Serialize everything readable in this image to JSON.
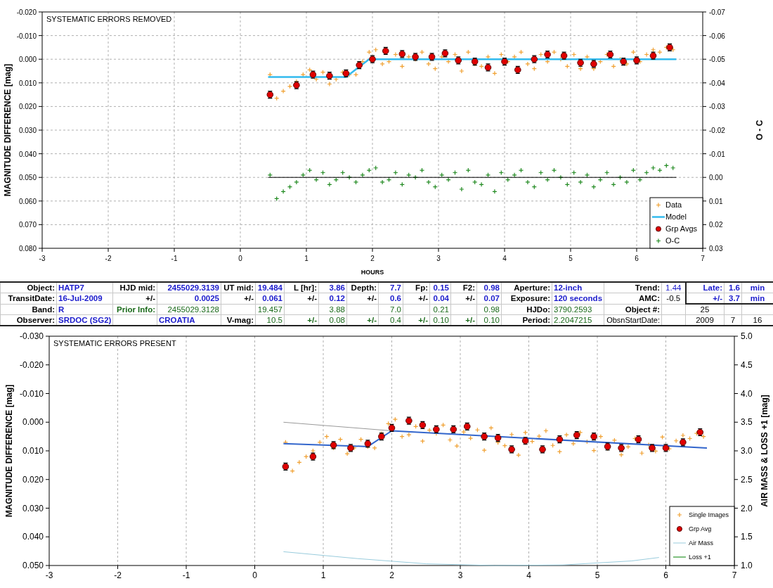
{
  "charts": [
    {
      "chart_data": {
        "type": "scatter",
        "title": "SYSTEMATIC ERRORS REMOVED",
        "xlabel": "HOURS",
        "ylabel": "MAGNITUDE DIFFERENCE [mag]",
        "y2label": "O - C",
        "xlim": [
          -3,
          7
        ],
        "ylim": [
          0.08,
          -0.02
        ],
        "y2lim": [
          0.03,
          -0.07
        ],
        "grid": true,
        "legend": "lower right",
        "xticks": [
          {
            "value": -3,
            "label": "-3"
          },
          {
            "value": -2,
            "label": "-2"
          },
          {
            "value": -1,
            "label": "-1"
          },
          {
            "value": 0,
            "label": "0"
          },
          {
            "value": 1,
            "label": "1"
          },
          {
            "value": 2,
            "label": "2"
          },
          {
            "value": 3,
            "label": "3"
          },
          {
            "value": 4,
            "label": "4"
          },
          {
            "value": 5,
            "label": "5"
          },
          {
            "value": 6,
            "label": "6"
          },
          {
            "value": 7,
            "label": "7"
          }
        ],
        "yticks": [
          {
            "value": -0.02,
            "label": "-0.020"
          },
          {
            "value": -0.01,
            "label": "-0.010"
          },
          {
            "value": 0,
            "label": "0.000"
          },
          {
            "value": 0.01,
            "label": "0.010"
          },
          {
            "value": 0.02,
            "label": "0.020"
          },
          {
            "value": 0.03,
            "label": "0.030"
          },
          {
            "value": 0.04,
            "label": "0.040"
          },
          {
            "value": 0.05,
            "label": "0.050"
          },
          {
            "value": 0.06,
            "label": "0.060"
          },
          {
            "value": 0.07,
            "label": "0.070"
          },
          {
            "value": 0.08,
            "label": "0.080"
          }
        ],
        "y2ticks": [
          {
            "value": -0.07,
            "label": "-0.07"
          },
          {
            "value": -0.06,
            "label": "-0.06"
          },
          {
            "value": -0.05,
            "label": "-0.05"
          },
          {
            "value": -0.04,
            "label": "-0.04"
          },
          {
            "value": -0.03,
            "label": "-0.03"
          },
          {
            "value": -0.02,
            "label": "-0.02"
          },
          {
            "value": -0.01,
            "label": "-0.01"
          },
          {
            "value": 0,
            "label": "0.00"
          },
          {
            "value": 0.01,
            "label": "0.01"
          },
          {
            "value": 0.02,
            "label": "0.02"
          },
          {
            "value": 0.03,
            "label": "0.03"
          }
        ],
        "series": [
          {
            "name": "Data",
            "type": "scatter",
            "color": "#f0a030",
            "x": [
              0.45,
              0.55,
              0.65,
              0.75,
              0.85,
              0.95,
              1.05,
              1.15,
              1.25,
              1.35,
              1.45,
              1.55,
              1.65,
              1.75,
              1.85,
              1.95,
              2.05,
              2.15,
              2.25,
              2.35,
              2.45,
              2.55,
              2.65,
              2.75,
              2.85,
              2.95,
              3.05,
              3.15,
              3.25,
              3.35,
              3.45,
              3.55,
              3.65,
              3.75,
              3.85,
              3.95,
              4.05,
              4.15,
              4.25,
              4.35,
              4.45,
              4.55,
              4.65,
              4.75,
              4.85,
              4.95,
              5.05,
              5.15,
              5.25,
              5.35,
              5.45,
              5.55,
              5.65,
              5.75,
              5.85,
              5.95,
              6.05,
              6.15,
              6.25,
              6.35,
              6.45,
              6.55
            ],
            "values": [
              0.0065,
              0.0165,
              0.0135,
              0.0115,
              0.0095,
              0.0065,
              0.0045,
              0.0085,
              0.0055,
              0.0105,
              0.0085,
              0.0055,
              0.0065,
              0.0065,
              0.001,
              -0.003,
              -0.004,
              0.002,
              0.001,
              -0.002,
              0.003,
              -0.001,
              0,
              -0.003,
              0.002,
              0.004,
              -0.001,
              0.001,
              -0.002,
              0.005,
              -0.003,
              0.002,
              0.003,
              -0.001,
              0.006,
              -0.002,
              0.001,
              -0.001,
              -0.003,
              0.002,
              0.004,
              -0.002,
              0.001,
              -0.003,
              0,
              0.003,
              -0.002,
              0.004,
              -0.001,
              0.004,
              0.001,
              -0.002,
              0.003,
              0,
              0.002,
              -0.003,
              0.001,
              -0.002,
              -0.004,
              -0.003,
              -0.005,
              -0.004
            ]
          },
          {
            "name": "Model",
            "type": "line",
            "color": "#33bbee",
            "x": [
              0.42,
              1.6,
              1.95,
              6.6
            ],
            "values": [
              0.0075,
              0.0075,
              0,
              0
            ]
          },
          {
            "name": "Grp Avgs",
            "type": "scatter",
            "marker": "circle",
            "color": "#e00000",
            "x": [
              0.45,
              0.85,
              1.1,
              1.35,
              1.6,
              1.8,
              2.0,
              2.2,
              2.45,
              2.65,
              2.9,
              3.1,
              3.3,
              3.55,
              3.75,
              4.0,
              4.2,
              4.45,
              4.65,
              4.9,
              5.15,
              5.35,
              5.6,
              5.8,
              6.0,
              6.25,
              6.5
            ],
            "values": [
              0.015,
              0.011,
              0.0065,
              0.007,
              0.006,
              0.0025,
              0,
              -0.0035,
              -0.0022,
              -0.001,
              -0.001,
              -0.0025,
              0.0005,
              0.001,
              0.0035,
              0.001,
              0.0045,
              0,
              -0.002,
              -0.0015,
              0.0015,
              0.002,
              -0.002,
              0.001,
              0.0005,
              -0.0015,
              -0.005
            ]
          },
          {
            "name": "O-C",
            "type": "scatter",
            "color": "#228b22",
            "axis": "y2",
            "x": [
              0.45,
              0.55,
              0.65,
              0.75,
              0.85,
              0.95,
              1.05,
              1.15,
              1.25,
              1.35,
              1.45,
              1.55,
              1.65,
              1.75,
              1.85,
              1.95,
              2.05,
              2.15,
              2.25,
              2.35,
              2.45,
              2.55,
              2.65,
              2.75,
              2.85,
              2.95,
              3.05,
              3.15,
              3.25,
              3.35,
              3.45,
              3.55,
              3.65,
              3.75,
              3.85,
              3.95,
              4.05,
              4.15,
              4.25,
              4.35,
              4.45,
              4.55,
              4.65,
              4.75,
              4.85,
              4.95,
              5.05,
              5.15,
              5.25,
              5.35,
              5.45,
              5.55,
              5.65,
              5.75,
              5.85,
              5.95,
              6.05,
              6.15,
              6.25,
              6.35,
              6.45,
              6.55
            ],
            "values": [
              -0.001,
              0.009,
              0.006,
              0.004,
              0.002,
              -0.001,
              -0.003,
              0.001,
              -0.002,
              0.003,
              0.001,
              -0.002,
              0,
              0.002,
              -0.001,
              -0.003,
              -0.004,
              0.002,
              0.001,
              -0.002,
              0.003,
              -0.001,
              0,
              -0.003,
              0.002,
              0.004,
              -0.001,
              0.001,
              -0.002,
              0.005,
              -0.003,
              0.002,
              0.003,
              -0.001,
              0.006,
              -0.002,
              0.001,
              -0.001,
              -0.003,
              0.002,
              0.004,
              -0.002,
              0.001,
              -0.003,
              0,
              0.003,
              -0.002,
              0.002,
              -0.001,
              0.004,
              0.001,
              -0.002,
              0.003,
              0,
              0.002,
              -0.003,
              0.001,
              -0.002,
              -0.004,
              -0.003,
              -0.005,
              -0.004
            ]
          },
          {
            "type": "line",
            "color": "#000000",
            "axis": "y2",
            "x": [
              0.42,
              6.6
            ],
            "values": [
              0,
              0
            ]
          }
        ]
      }
    },
    {
      "chart_data": {
        "type": "scatter",
        "title": "SYSTEMATIC ERRORS PRESENT",
        "ylabel": "MAGNITUDE DIFFERENCE [mag]",
        "y2label": "AIR MASS & LOSS +1 [mag]",
        "xlim": [
          -3,
          7
        ],
        "ylim": [
          0.05,
          -0.03
        ],
        "y2lim": [
          1,
          5
        ],
        "grid": true,
        "legend": "lower right",
        "xticks": [
          {
            "value": -3,
            "label": "-3"
          },
          {
            "value": -2,
            "label": "-2"
          },
          {
            "value": -1,
            "label": "-1"
          },
          {
            "value": 0,
            "label": "0"
          },
          {
            "value": 1,
            "label": "1"
          },
          {
            "value": 2,
            "label": "2"
          },
          {
            "value": 3,
            "label": "3"
          },
          {
            "value": 4,
            "label": "4"
          },
          {
            "value": 5,
            "label": "5"
          },
          {
            "value": 6,
            "label": "6"
          },
          {
            "value": 7,
            "label": "7"
          }
        ],
        "yticks": [
          {
            "value": -0.03,
            "label": "-0.030"
          },
          {
            "value": -0.02,
            "label": "-0.020"
          },
          {
            "value": -0.01,
            "label": "-0.010"
          },
          {
            "value": 0,
            "label": "0.000"
          },
          {
            "value": 0.01,
            "label": "0.010"
          },
          {
            "value": 0.02,
            "label": "0.020"
          },
          {
            "value": 0.03,
            "label": "0.030"
          },
          {
            "value": 0.04,
            "label": "0.040"
          },
          {
            "value": 0.05,
            "label": "0.050"
          }
        ],
        "y2ticks": [
          {
            "value": 1,
            "label": "1.0"
          },
          {
            "value": 1.5,
            "label": "1.5"
          },
          {
            "value": 2,
            "label": "2.0"
          },
          {
            "value": 2.5,
            "label": "2.5"
          },
          {
            "value": 3,
            "label": "3.0"
          },
          {
            "value": 3.5,
            "label": "3.5"
          },
          {
            "value": 4,
            "label": "4.0"
          },
          {
            "value": 4.5,
            "label": "4.5"
          },
          {
            "value": 5,
            "label": "5.0"
          }
        ],
        "series": [
          {
            "type": "line",
            "color": "#999999",
            "x": [
              0.42,
              2.0
            ],
            "values": [
              0,
              0.003
            ]
          },
          {
            "name": "Single Images",
            "type": "scatter",
            "color": "#f0a030",
            "x": [
              0.45,
              0.55,
              0.65,
              0.75,
              0.85,
              0.95,
              1.05,
              1.15,
              1.25,
              1.35,
              1.45,
              1.55,
              1.65,
              1.75,
              1.85,
              1.95,
              2.05,
              2.15,
              2.25,
              2.35,
              2.45,
              2.55,
              2.65,
              2.75,
              2.85,
              2.95,
              3.05,
              3.15,
              3.25,
              3.35,
              3.45,
              3.55,
              3.65,
              3.75,
              3.85,
              3.95,
              4.05,
              4.15,
              4.25,
              4.35,
              4.45,
              4.55,
              4.65,
              4.75,
              4.85,
              4.95,
              5.05,
              5.15,
              5.25,
              5.35,
              5.45,
              5.55,
              5.65,
              5.75,
              5.85,
              5.95,
              6.05,
              6.15,
              6.25,
              6.35,
              6.45,
              6.55
            ],
            "values": [
              0.007,
              0.017,
              0.014,
              0.012,
              0.01,
              0.007,
              0.005,
              0.009,
              0.006,
              0.011,
              0.009,
              0.006,
              0.0085,
              0.009,
              0.004,
              0.0005,
              -0.001,
              0.005,
              0.0044,
              0.0015,
              0.0066,
              0.0028,
              0.0039,
              0.001,
              0.0062,
              0.0083,
              0.0034,
              0.0056,
              0.0027,
              0.0098,
              0.002,
              0.0071,
              0.0082,
              0.0043,
              0.0115,
              0.0036,
              0.0067,
              0.0049,
              0.003,
              0.0081,
              0.0103,
              0.0044,
              0.0075,
              0.0036,
              0.0068,
              0.0099,
              0.005,
              0.0092,
              0.0063,
              0.0114,
              0.0086,
              0.0057,
              0.0108,
              0.0079,
              0.0101,
              0.0052,
              0.0093,
              0.0065,
              0.0046,
              0.0057,
              0.0039,
              0.005
            ]
          },
          {
            "type": "line",
            "color": "#3366cc",
            "x": [
              0.42,
              1.65,
              2.0,
              6.6
            ],
            "values": [
              0.0075,
              0.0085,
              0.003,
              0.009
            ]
          },
          {
            "name": "Grp Avg",
            "type": "scatter",
            "marker": "circle",
            "color": "#e00000",
            "x": [
              0.45,
              0.85,
              1.15,
              1.4,
              1.65,
              1.85,
              2.0,
              2.25,
              2.45,
              2.65,
              2.9,
              3.1,
              3.35,
              3.55,
              3.75,
              3.95,
              4.2,
              4.45,
              4.7,
              4.95,
              5.15,
              5.35,
              5.6,
              5.8,
              6.0,
              6.25,
              6.5
            ],
            "values": [
              0.0155,
              0.012,
              0.008,
              0.009,
              0.0075,
              0.005,
              0.002,
              -0.0005,
              0.001,
              0.0025,
              0.0025,
              0.0015,
              0.005,
              0.0055,
              0.0095,
              0.0065,
              0.0095,
              0.006,
              0.0045,
              0.005,
              0.0085,
              0.009,
              0.006,
              0.009,
              0.009,
              0.007,
              0.0035
            ]
          },
          {
            "name": "Air Mass",
            "type": "line",
            "color": "#99ccdd",
            "axis": "y2",
            "x": [
              0.42,
              1.5,
              2.5,
              3.5,
              4.5,
              5.5,
              5.9
            ],
            "values": [
              1.24,
              1.12,
              1.03,
              1.0,
              1.01,
              1.08,
              1.14
            ]
          },
          {
            "name": "Loss +1",
            "type": "line",
            "color": "#008000",
            "axis": "y2"
          }
        ]
      }
    }
  ],
  "table": {
    "rows": [
      [
        {
          "text": "Object:",
          "kind": "label"
        },
        {
          "text": "HATP7",
          "kind": "text"
        },
        {
          "text": "HJD mid:",
          "kind": "label"
        },
        {
          "text": "2455029.3139",
          "kind": "value"
        },
        {
          "text": "UT mid:",
          "kind": "label"
        },
        {
          "text": "19.484",
          "kind": "value"
        },
        {
          "text": "L [hr]:",
          "kind": "label"
        },
        {
          "text": "3.86",
          "kind": "value"
        },
        {
          "text": "Depth:",
          "kind": "label"
        },
        {
          "text": "7.7",
          "kind": "value"
        },
        {
          "text": "Fp:",
          "kind": "label"
        },
        {
          "text": "0.15",
          "kind": "value"
        },
        {
          "text": "F2:",
          "kind": "label"
        },
        {
          "text": "0.98",
          "kind": "value"
        },
        {
          "text": "Aperture:",
          "kind": "label"
        },
        {
          "text": "12-inch",
          "kind": "text"
        },
        {
          "text": "Trend:",
          "kind": "label"
        },
        {
          "text": "1.44",
          "kind": "blue"
        },
        {
          "text": "Late:",
          "kind": "value",
          "highlight": true
        },
        {
          "text": "1.6",
          "kind": "value",
          "highlight": true
        },
        {
          "text": "min",
          "kind": "unit",
          "highlight": true
        }
      ],
      [
        {
          "text": "TransitDate:",
          "kind": "label"
        },
        {
          "text": "16-Jul-2009",
          "kind": "text"
        },
        {
          "text": "+/-",
          "kind": "label"
        },
        {
          "text": "0.0025",
          "kind": "value"
        },
        {
          "text": "+/-",
          "kind": "label"
        },
        {
          "text": "0.061",
          "kind": "value"
        },
        {
          "text": "+/-",
          "kind": "label"
        },
        {
          "text": "0.12",
          "kind": "value"
        },
        {
          "text": "+/-",
          "kind": "label"
        },
        {
          "text": "0.6",
          "kind": "value"
        },
        {
          "text": "+/-",
          "kind": "label"
        },
        {
          "text": "0.04",
          "kind": "value"
        },
        {
          "text": "+/-",
          "kind": "label"
        },
        {
          "text": "0.07",
          "kind": "value"
        },
        {
          "text": "Exposure:",
          "kind": "label"
        },
        {
          "text": "120 seconds",
          "kind": "text"
        },
        {
          "text": "AMC:",
          "kind": "label"
        },
        {
          "text": "-0.5",
          "kind": "plain"
        },
        {
          "text": "+/-",
          "kind": "value",
          "highlight": true
        },
        {
          "text": "3.7",
          "kind": "value",
          "highlight": true
        },
        {
          "text": "min",
          "kind": "unit",
          "highlight": true
        }
      ],
      [
        {
          "text": "Band:",
          "kind": "label"
        },
        {
          "text": "R",
          "kind": "text"
        },
        {
          "text": "Prior Info:",
          "kind": "infolabel"
        },
        {
          "text": "2455029.3128",
          "kind": "info"
        },
        {
          "kind": "empty"
        },
        {
          "text": "19.457",
          "kind": "info"
        },
        {
          "kind": "empty"
        },
        {
          "text": "3.88",
          "kind": "info"
        },
        {
          "kind": "empty"
        },
        {
          "text": "7.0",
          "kind": "info"
        },
        {
          "kind": "empty"
        },
        {
          "text": "0.21",
          "kind": "info"
        },
        {
          "kind": "empty"
        },
        {
          "text": "0.98",
          "kind": "info"
        },
        {
          "text": "HJDo:",
          "kind": "label"
        },
        {
          "text": "3790.2593",
          "kind": "infotext"
        },
        {
          "text": "Object #:",
          "kind": "label"
        },
        {
          "kind": "empty"
        },
        {
          "text": "25",
          "kind": "plain"
        },
        {
          "kind": "empty"
        },
        {
          "kind": "empty"
        }
      ],
      [
        {
          "text": "Observer:",
          "kind": "label"
        },
        {
          "text": "SRDOC (SG2)",
          "kind": "text"
        },
        {
          "kind": "empty"
        },
        {
          "text": "CROATIA",
          "kind": "text"
        },
        {
          "text": "V-mag:",
          "kind": "label"
        },
        {
          "text": "10.5",
          "kind": "info"
        },
        {
          "text": "+/-",
          "kind": "infolabel"
        },
        {
          "text": "0.08",
          "kind": "info"
        },
        {
          "text": "+/-",
          "kind": "infolabel"
        },
        {
          "text": "0.4",
          "kind": "info"
        },
        {
          "text": "+/-",
          "kind": "infolabel"
        },
        {
          "text": "0.10",
          "kind": "info"
        },
        {
          "text": "+/-",
          "kind": "infolabel"
        },
        {
          "text": "0.10",
          "kind": "info"
        },
        {
          "text": "Period:",
          "kind": "label"
        },
        {
          "text": "2.2047215",
          "kind": "infotext"
        },
        {
          "text": "ObsnStartDate:",
          "kind": "plainlabel"
        },
        {
          "kind": "empty"
        },
        {
          "text": "2009",
          "kind": "plain"
        },
        {
          "text": "7",
          "kind": "plain"
        },
        {
          "text": "16",
          "kind": "plain"
        }
      ]
    ]
  }
}
